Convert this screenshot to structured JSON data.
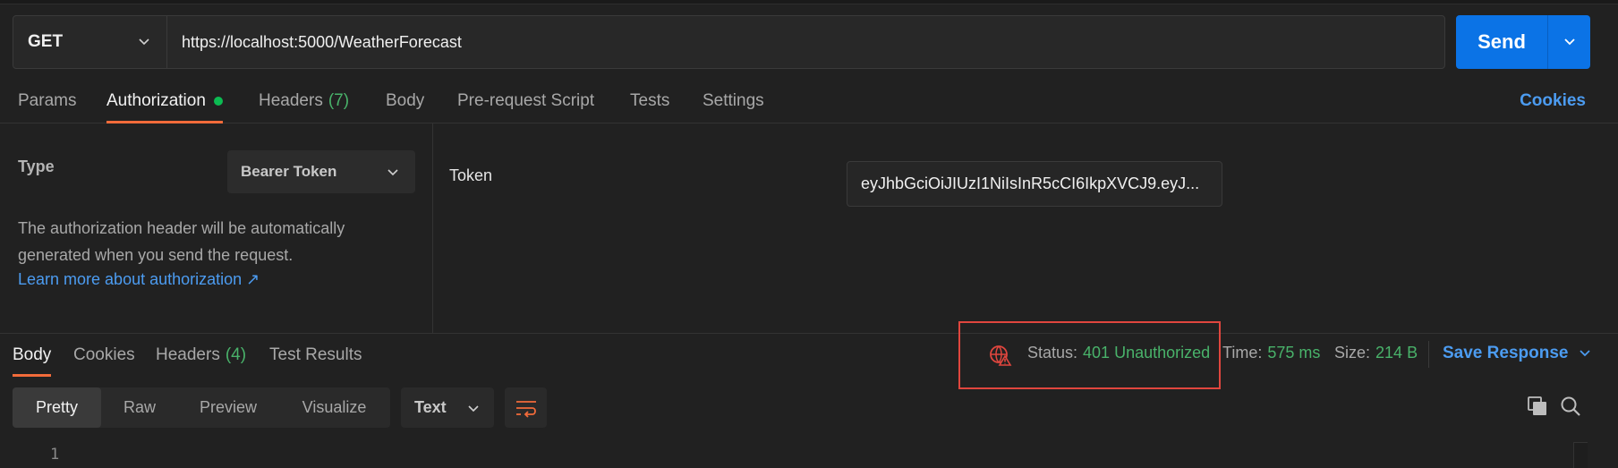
{
  "request": {
    "method": "GET",
    "url": "https://localhost:5000/WeatherForecast",
    "send_label": "Send"
  },
  "req_tabs": [
    {
      "label": "Params"
    },
    {
      "label": "Authorization"
    },
    {
      "label": "Headers",
      "count": "(7)"
    },
    {
      "label": "Body"
    },
    {
      "label": "Pre-request Script"
    },
    {
      "label": "Tests"
    },
    {
      "label": "Settings"
    }
  ],
  "cookies_link": "Cookies",
  "auth": {
    "type_label": "Type",
    "type_value": "Bearer Token",
    "description": "The authorization header will be automatically generated when you send the request.",
    "learn_more": "Learn more about authorization ↗",
    "token_label": "Token",
    "token_value": "eyJhbGciOiJIUzI1NiIsInR5cCI6IkpXVCJ9.eyJ..."
  },
  "resp_tabs": [
    {
      "label": "Body"
    },
    {
      "label": "Cookies"
    },
    {
      "label": "Headers",
      "count": "(4)"
    },
    {
      "label": "Test Results"
    }
  ],
  "response": {
    "status_label": "Status:",
    "status_value": "401 Unauthorized",
    "time_label": "Time:",
    "time_value": "575 ms",
    "size_label": "Size:",
    "size_value": "214 B",
    "save_label": "Save Response"
  },
  "format": {
    "modes": [
      "Pretty",
      "Raw",
      "Preview",
      "Visualize"
    ],
    "type": "Text"
  },
  "editor": {
    "line_number": "1"
  },
  "colors": {
    "accent": "#f26b3a",
    "send": "#0b73e6",
    "link": "#4c9cf1",
    "success": "#49b26a",
    "highlight": "#e0463e"
  }
}
